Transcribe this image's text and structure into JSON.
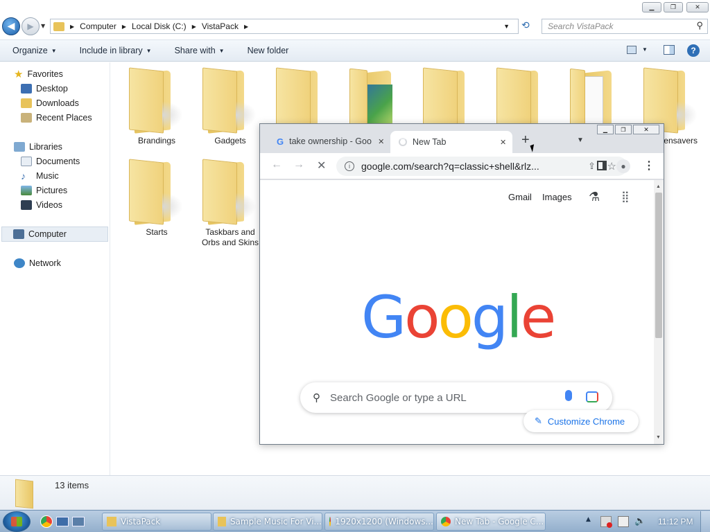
{
  "explorer": {
    "address": {
      "segments": [
        "Computer",
        "Local Disk (C:)",
        "VistaPack"
      ]
    },
    "search_placeholder": "Search VistaPack",
    "commands": {
      "organize": "Organize",
      "include_in_library": "Include in library",
      "share_with": "Share with",
      "new_folder": "New folder"
    },
    "nav": {
      "favorites": "Favorites",
      "desktop": "Desktop",
      "downloads": "Downloads",
      "recent_places": "Recent Places",
      "libraries": "Libraries",
      "documents": "Documents",
      "music": "Music",
      "pictures": "Pictures",
      "videos": "Videos",
      "computer": "Computer",
      "network": "Network"
    },
    "folders": [
      {
        "name": "Brandings"
      },
      {
        "name": "Gadgets"
      },
      {
        "name": ""
      },
      {
        "name": ""
      },
      {
        "name": ""
      },
      {
        "name": ""
      },
      {
        "name": ""
      },
      {
        "name": "ensavers"
      },
      {
        "name": "Starts"
      },
      {
        "name": "Taskbars and Orbs and Skins"
      }
    ],
    "status": {
      "item_count": "13 items"
    }
  },
  "chrome": {
    "tabs": [
      {
        "title": "take ownership - Goo",
        "active": false
      },
      {
        "title": "New Tab",
        "active": true
      }
    ],
    "omnibox_url": "google.com/search?q=classic+shell&rlz...",
    "page": {
      "links": {
        "gmail": "Gmail",
        "images": "Images"
      },
      "logo_letters": [
        "G",
        "o",
        "o",
        "g",
        "l",
        "e"
      ],
      "logo_colors": [
        "#4285F4",
        "#EA4335",
        "#FBBC05",
        "#4285F4",
        "#34A853",
        "#EA4335"
      ],
      "search_placeholder": "Search Google or type a URL",
      "customize": "Customize Chrome"
    }
  },
  "taskbar": {
    "buttons": [
      {
        "label": "VistaPack"
      },
      {
        "label": "Sample Music For Vi..."
      },
      {
        "label": "1920x1200 (Windows..."
      },
      {
        "label": "New Tab - Google C..."
      }
    ],
    "clock": "11:12 PM"
  },
  "colors": {
    "taskbar": "#a7bfd8",
    "chrome_frame": "#dee1e6",
    "google_blue": "#1a73e8"
  }
}
